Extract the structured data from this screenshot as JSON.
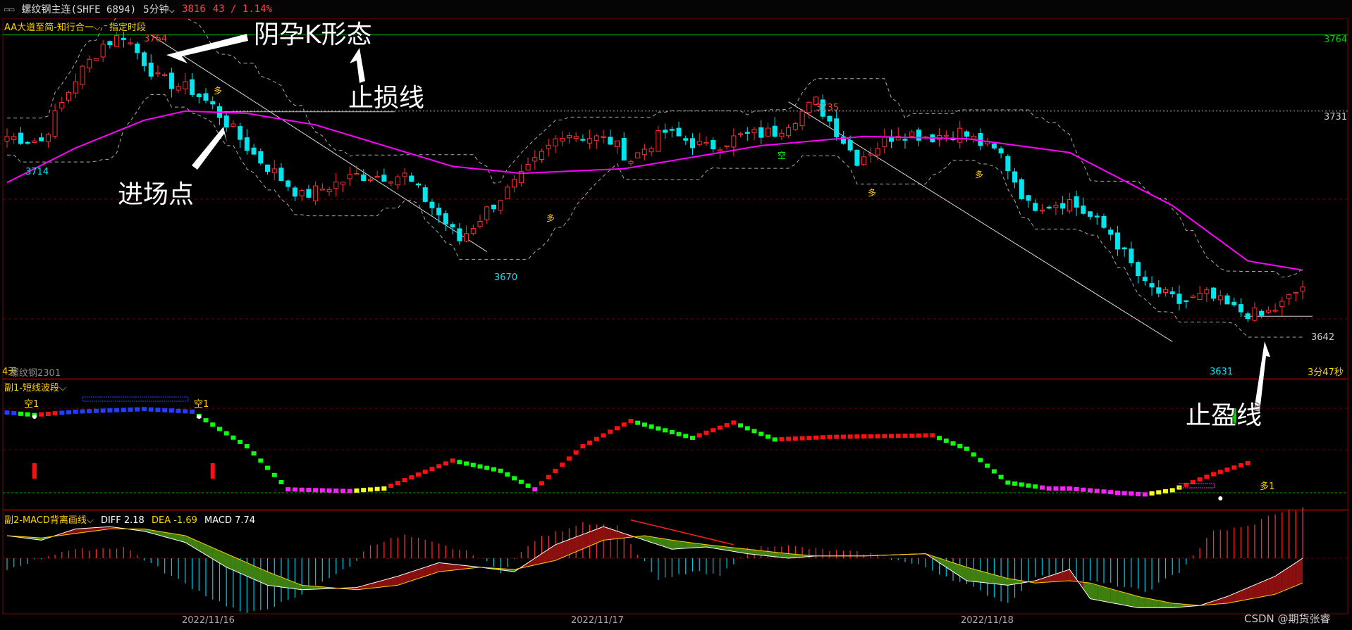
{
  "header": {
    "window_icon": "window-icon",
    "symbol": "螺纹钢主连(SHFE 6894)",
    "period": "5分钟",
    "price": "3816",
    "change": "43 / 1.14%"
  },
  "main_panel": {
    "indicator": "AA大道至简-知行合一",
    "indicator_option": "指定时段",
    "contract": "螺纹钢2301",
    "days": "4天",
    "countdown": "3分47秒"
  },
  "sub1": {
    "title": "副1-短线波段",
    "signals": [
      "空1",
      "空1",
      "多1"
    ]
  },
  "sub2": {
    "title": "副2-MACD背离画线",
    "diff": "DIFF 2.18",
    "dea": "DEA -1.69",
    "macd": "MACD 7.74"
  },
  "dates": [
    "2022/11/16",
    "2022/11/17",
    "2022/11/18"
  ],
  "watermark": "CSDN @期货张睿",
  "annotations": {
    "pattern": "阴孕K形态",
    "stop_loss": "止损线",
    "entry": "进场点",
    "take_profit": "止盈线"
  },
  "price_levels": {
    "stop_loss": "3764",
    "dotted_level": "3731",
    "take_profit": "3642"
  },
  "extreme_labels": [
    "3764",
    "3714",
    "3670",
    "3735",
    "3631"
  ],
  "signal_marks": [
    "空",
    "多",
    "多",
    "多",
    "多"
  ],
  "colors": {
    "up": "#ff3030",
    "down": "#00e5ee",
    "ma": "#ff00ff",
    "stop_line": "#00cc00",
    "diff": "#ffffff",
    "dea": "#ffd000"
  },
  "chart_data": {
    "type": "candlestick",
    "unit": "5分钟",
    "ylim": [
      3625,
      3770
    ],
    "close_trajectory": [
      [
        0,
        3720
      ],
      [
        5,
        3718
      ],
      [
        10,
        3745
      ],
      [
        14,
        3760
      ],
      [
        17,
        3764
      ],
      [
        22,
        3745
      ],
      [
        27,
        3740
      ],
      [
        30,
        3733
      ],
      [
        36,
        3712
      ],
      [
        43,
        3694
      ],
      [
        51,
        3703
      ],
      [
        58,
        3703
      ],
      [
        63,
        3686
      ],
      [
        66,
        3675
      ],
      [
        70,
        3688
      ],
      [
        75,
        3702
      ],
      [
        81,
        3722
      ],
      [
        88,
        3718
      ],
      [
        91,
        3710
      ],
      [
        96,
        3722
      ],
      [
        102,
        3715
      ],
      [
        107,
        3720
      ],
      [
        112,
        3722
      ],
      [
        118,
        3735
      ],
      [
        124,
        3710
      ],
      [
        130,
        3722
      ],
      [
        135,
        3720
      ],
      [
        139,
        3722
      ],
      [
        145,
        3712
      ],
      [
        149,
        3690
      ],
      [
        155,
        3692
      ],
      [
        161,
        3678
      ],
      [
        166,
        3655
      ],
      [
        171,
        3648
      ],
      [
        175,
        3651
      ],
      [
        179,
        3645
      ],
      [
        183,
        3642
      ],
      [
        186,
        3647
      ],
      [
        189,
        3655
      ]
    ],
    "moving_average": [
      [
        0,
        3700
      ],
      [
        10,
        3715
      ],
      [
        20,
        3727
      ],
      [
        26,
        3731
      ],
      [
        35,
        3730
      ],
      [
        45,
        3725
      ],
      [
        55,
        3716
      ],
      [
        65,
        3707
      ],
      [
        75,
        3704
      ],
      [
        90,
        3706
      ],
      [
        110,
        3716
      ],
      [
        125,
        3720
      ],
      [
        140,
        3719
      ],
      [
        155,
        3713
      ],
      [
        170,
        3690
      ],
      [
        181,
        3666
      ],
      [
        189,
        3662
      ]
    ],
    "marked_levels": [
      3764,
      3731,
      3642
    ],
    "extremes": [
      {
        "label": "3764",
        "x": 21,
        "y": 3764
      },
      {
        "label": "3714",
        "x": 5,
        "y": 3714
      },
      {
        "label": "3670",
        "x": 70,
        "y": 3670
      },
      {
        "label": "3735",
        "x": 114,
        "y": 3735
      },
      {
        "label": "3631",
        "x": 170,
        "y": 3631
      }
    ],
    "short_wave": [
      [
        0,
        0.95
      ],
      [
        4,
        0.92
      ],
      [
        10,
        0.96
      ],
      [
        20,
        0.99
      ],
      [
        27,
        0.96
      ],
      [
        35,
        0.55
      ],
      [
        41,
        0.04
      ],
      [
        50,
        0.02
      ],
      [
        55,
        0.05
      ],
      [
        65,
        0.38
      ],
      [
        72,
        0.26
      ],
      [
        77,
        0.04
      ],
      [
        84,
        0.55
      ],
      [
        91,
        0.85
      ],
      [
        100,
        0.65
      ],
      [
        106,
        0.83
      ],
      [
        112,
        0.63
      ],
      [
        120,
        0.66
      ],
      [
        135,
        0.68
      ],
      [
        140,
        0.52
      ],
      [
        146,
        0.12
      ],
      [
        152,
        0.05
      ],
      [
        155,
        0.05
      ],
      [
        162,
        0.0
      ],
      [
        166,
        -0.02
      ],
      [
        170,
        0.03
      ],
      [
        176,
        0.22
      ],
      [
        181,
        0.35
      ]
    ],
    "macd_histogram": [
      [
        0,
        -5
      ],
      [
        8,
        3
      ],
      [
        12,
        4
      ],
      [
        17,
        5
      ],
      [
        24,
        -8
      ],
      [
        30,
        -18
      ],
      [
        35,
        -25
      ],
      [
        42,
        -18
      ],
      [
        46,
        -10
      ],
      [
        50,
        -4
      ],
      [
        53,
        6
      ],
      [
        58,
        10
      ],
      [
        63,
        6
      ],
      [
        68,
        2
      ],
      [
        72,
        -6
      ],
      [
        77,
        8
      ],
      [
        84,
        16
      ],
      [
        89,
        14
      ],
      [
        95,
        -10
      ],
      [
        100,
        -6
      ],
      [
        104,
        -8
      ],
      [
        108,
        4
      ],
      [
        112,
        6
      ],
      [
        118,
        4
      ],
      [
        126,
        2
      ],
      [
        134,
        -4
      ],
      [
        140,
        -12
      ],
      [
        146,
        -20
      ],
      [
        150,
        -8
      ],
      [
        157,
        -10
      ],
      [
        162,
        -12
      ],
      [
        166,
        -15
      ],
      [
        171,
        -6
      ],
      [
        176,
        12
      ],
      [
        181,
        14
      ],
      [
        185,
        20
      ],
      [
        189,
        22
      ]
    ],
    "macd_diff": [
      [
        0,
        10
      ],
      [
        5,
        8
      ],
      [
        10,
        13
      ],
      [
        15,
        14
      ],
      [
        20,
        12
      ],
      [
        26,
        7
      ],
      [
        32,
        -4
      ],
      [
        38,
        -12
      ],
      [
        43,
        -14
      ],
      [
        51,
        -13
      ],
      [
        57,
        -8
      ],
      [
        63,
        -2
      ],
      [
        69,
        -4
      ],
      [
        74,
        -6
      ],
      [
        80,
        6
      ],
      [
        87,
        14
      ],
      [
        93,
        8
      ],
      [
        97,
        4
      ],
      [
        102,
        5
      ],
      [
        108,
        2
      ],
      [
        114,
        0
      ],
      [
        118,
        1
      ],
      [
        125,
        1
      ],
      [
        134,
        2
      ],
      [
        140,
        -10
      ],
      [
        146,
        -12
      ],
      [
        150,
        -10
      ],
      [
        155,
        -5
      ],
      [
        158,
        -18
      ],
      [
        165,
        -22
      ],
      [
        170,
        -22
      ],
      [
        174,
        -21
      ],
      [
        178,
        -17
      ],
      [
        185,
        -8
      ],
      [
        189,
        0
      ]
    ],
    "macd_dea": [
      [
        0,
        10
      ],
      [
        5,
        9
      ],
      [
        10,
        11
      ],
      [
        15,
        13
      ],
      [
        20,
        13
      ],
      [
        26,
        10
      ],
      [
        32,
        2
      ],
      [
        38,
        -6
      ],
      [
        43,
        -12
      ],
      [
        51,
        -14
      ],
      [
        57,
        -12
      ],
      [
        63,
        -6
      ],
      [
        69,
        -4
      ],
      [
        74,
        -5
      ],
      [
        80,
        -1
      ],
      [
        87,
        8
      ],
      [
        93,
        10
      ],
      [
        97,
        8
      ],
      [
        102,
        6
      ],
      [
        108,
        4
      ],
      [
        114,
        2
      ],
      [
        118,
        1
      ],
      [
        125,
        1
      ],
      [
        134,
        2
      ],
      [
        140,
        -4
      ],
      [
        146,
        -9
      ],
      [
        150,
        -11
      ],
      [
        155,
        -10
      ],
      [
        158,
        -11
      ],
      [
        165,
        -17
      ],
      [
        170,
        -20
      ],
      [
        174,
        -21
      ],
      [
        178,
        -20
      ],
      [
        185,
        -16
      ],
      [
        189,
        -11
      ]
    ]
  }
}
